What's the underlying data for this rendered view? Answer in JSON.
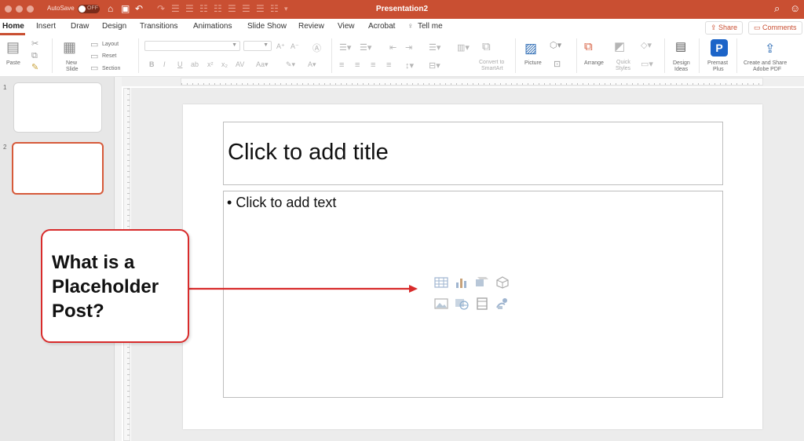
{
  "titlebar": {
    "autosave_label": "AutoSave",
    "autosave_state": "OFF",
    "document_title": "Presentation2",
    "accent_color": "#c94f32"
  },
  "tabs": [
    {
      "label": "Home",
      "active": true
    },
    {
      "label": "Insert"
    },
    {
      "label": "Draw"
    },
    {
      "label": "Design"
    },
    {
      "label": "Transitions"
    },
    {
      "label": "Animations"
    },
    {
      "label": "Slide Show"
    },
    {
      "label": "Review"
    },
    {
      "label": "View"
    },
    {
      "label": "Acrobat"
    },
    {
      "label": "Tell me"
    }
  ],
  "actions": {
    "share": "Share",
    "comments": "Comments"
  },
  "ribbon": {
    "paste": "Paste",
    "new_slide_line1": "New",
    "new_slide_line2": "Slide",
    "layout": "Layout",
    "reset": "Reset",
    "section": "Section",
    "convert_line1": "Convert to",
    "convert_line2": "SmartArt",
    "picture": "Picture",
    "arrange": "Arrange",
    "quick_styles_line1": "Quick",
    "quick_styles_line2": "Styles",
    "design_ideas_line1": "Design",
    "design_ideas_line2": "Ideas",
    "premast_line1": "Premast",
    "premast_line2": "Plus",
    "adobe_line1": "Create and Share",
    "adobe_line2": "Adobe PDF"
  },
  "thumbnails": [
    {
      "number": "1"
    },
    {
      "number": "2",
      "selected": true
    }
  ],
  "slide": {
    "title_placeholder": "Click to add title",
    "body_placeholder": "Click to add text",
    "bullet": "•"
  },
  "callout": {
    "text": "What is a Placeholder Post?",
    "border_color": "#d82b2b"
  }
}
